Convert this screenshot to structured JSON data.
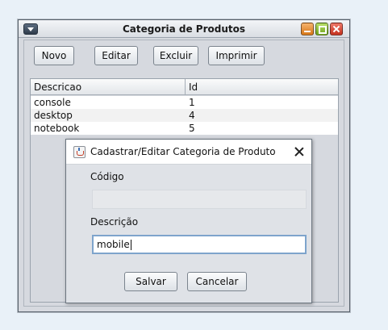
{
  "main_window": {
    "title": "Categoria de Produtos",
    "toolbar": {
      "novo_label": "Novo",
      "editar_label": "Editar",
      "excluir_label": "Excluir",
      "imprimir_label": "Imprimir"
    },
    "table": {
      "columns": [
        "Descricao",
        "Id"
      ],
      "rows": [
        {
          "descricao": "console",
          "id": "1"
        },
        {
          "descricao": "desktop",
          "id": "4"
        },
        {
          "descricao": "notebook",
          "id": "5"
        }
      ]
    }
  },
  "dialog": {
    "title": "Cadastrar/Editar Categoria de Produto",
    "codigo_label": "Código",
    "codigo_value": "",
    "descricao_label": "Descrição",
    "descricao_value": "mobile",
    "salvar_label": "Salvar",
    "cancelar_label": "Cancelar"
  },
  "icons": {
    "system_menu": "chevron-down-icon",
    "minimize": "minimize-icon",
    "maximize": "maximize-icon",
    "close": "close-icon",
    "dialog_app": "java-coffee-icon",
    "dialog_close": "close-icon"
  },
  "colors": {
    "minimize": "#e58a2b",
    "maximize": "#8cc03b",
    "close": "#d9412e",
    "focus_border": "#7ea4cc"
  }
}
